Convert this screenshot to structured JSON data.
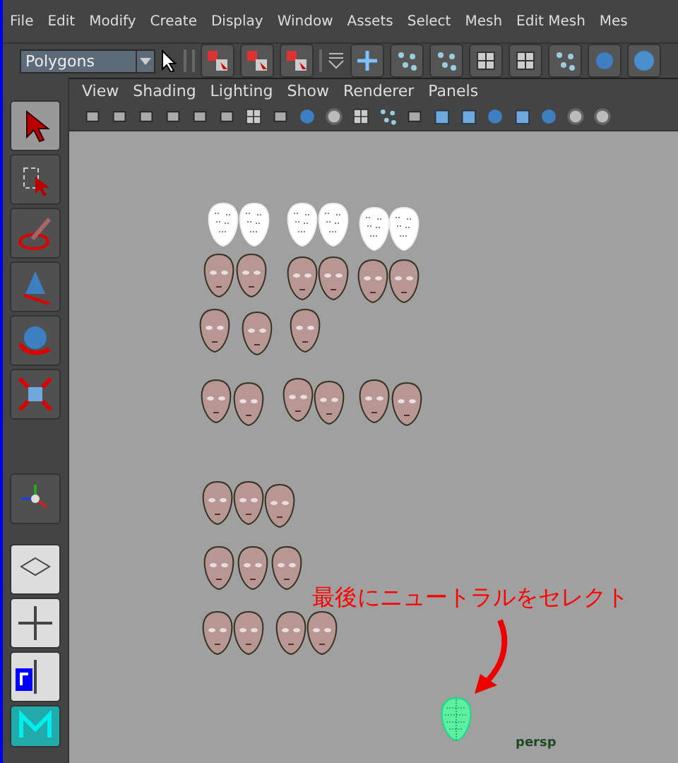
{
  "menu_bar": {
    "items": [
      "File",
      "Edit",
      "Modify",
      "Create",
      "Display",
      "Window",
      "Assets",
      "Select",
      "Mesh",
      "Edit Mesh",
      "Mes"
    ]
  },
  "shelf": {
    "menu_set": "Polygons"
  },
  "panel": {
    "menu": [
      "View",
      "Shading",
      "Lighting",
      "Show",
      "Renderer",
      "Panels"
    ]
  },
  "viewport": {
    "annotation": "最後にニュートラルをセレクト",
    "camera": "persp",
    "target_head": {
      "selected": true
    }
  }
}
